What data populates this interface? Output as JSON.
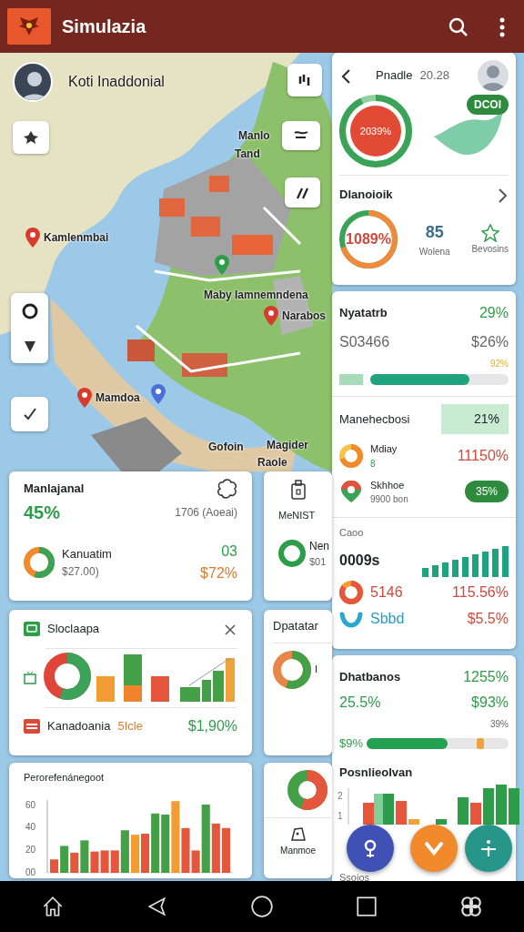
{
  "app_bar": {
    "title": "Simulazia"
  },
  "map": {
    "user_label": "Koti Inaddonial",
    "places": [
      {
        "label": "Kamlenmbai",
        "pin": true
      },
      {
        "label": "Manlo",
        "pin": false
      },
      {
        "label": "Tand",
        "pin": false
      },
      {
        "label": "Maby Iamnemndena",
        "pin": false
      },
      {
        "label": "Narabos",
        "pin": true
      },
      {
        "label": "Mamdoa",
        "pin": true
      },
      {
        "label": "Gofoin",
        "pin": false
      },
      {
        "label": "Magider",
        "pin": false
      },
      {
        "label": "Raole",
        "pin": false
      }
    ]
  },
  "profile_card": {
    "title": "Pnadle",
    "time": "20.28",
    "gauge": {
      "value": "2039%"
    },
    "badge": "DCOI",
    "section_title": "Dlanoioik",
    "stats": [
      {
        "kind": "gauge",
        "value": "1089%"
      },
      {
        "kind": "number",
        "value": "85",
        "label": "Wolena"
      },
      {
        "kind": "star",
        "label": "Bevosins"
      }
    ]
  },
  "stats_card": {
    "title": "Nyatatrb",
    "title_value": "29%",
    "subtitle": "S03466",
    "subtitle_value": "$26%",
    "progress": {
      "reading": "92%",
      "level": 0.72
    },
    "highlight": {
      "label": "Manehecbosi",
      "value": "21%"
    },
    "items": [
      {
        "kind": "ring",
        "title": "Mdiay",
        "subtitle": "8",
        "value": "11150%"
      },
      {
        "kind": "pin",
        "title": "Skhhoe",
        "subtitle": "9900 bon",
        "badge": "35%"
      }
    ],
    "trend": {
      "label": "Caoo",
      "value": "0009s"
    },
    "rows": [
      {
        "kind": "ring",
        "label": "5146",
        "value": "115.56%"
      },
      {
        "kind": "check",
        "label": "Sbbd",
        "value": "$5.5%"
      }
    ]
  },
  "finance_card": {
    "title": "Dhatbanos",
    "title_value": "1255%",
    "left_value": "25.5%",
    "right_value": "$93%",
    "progress": {
      "label": "$9%",
      "reading": "39%",
      "level": 0.57
    },
    "marker": {
      "level": 0.8
    },
    "chart_title": "Posnlieolvan",
    "chart_ticks": [
      "2",
      "1"
    ],
    "footer": "Ssoios"
  },
  "summary_card": {
    "title": "Manlajanal",
    "value": "45%",
    "note": "1706 (Aoeai)",
    "item": {
      "title": "Kanuatim",
      "subtitle": "$27.00)",
      "value": "03",
      "change": "$72%"
    }
  },
  "side_card_top": {
    "label": "MeNIST",
    "item_title": "Nen",
    "item_subtitle": "$01"
  },
  "chart_card": {
    "title": "Sloclaapa",
    "footer_label": "Kanadoania",
    "footer_tag": "5Icle",
    "footer_value": "$1,90%"
  },
  "side_card_middle": {
    "title": "Dpatatar",
    "note": "I"
  },
  "bar_chart_card": {
    "chart_data": {
      "type": "bar",
      "title": "Perorefenánegoot",
      "categories": [
        null,
        null,
        null,
        null,
        null,
        null,
        null,
        null,
        null,
        null,
        null,
        null,
        null,
        null,
        null,
        null,
        null,
        null
      ],
      "ylim": [
        0,
        65
      ],
      "yticks": [
        {
          "value": 0,
          "label": "00"
        },
        {
          "value": 20,
          "label": "20"
        },
        {
          "value": 40,
          "label": "40"
        },
        {
          "value": 60,
          "label": "60"
        }
      ],
      "series": [
        {
          "color": "#43a047",
          "values": [
            null,
            24,
            null,
            29,
            null,
            null,
            null,
            38,
            null,
            null,
            53,
            52,
            null,
            null,
            null,
            61,
            null,
            null
          ]
        },
        {
          "color": "#f39c34",
          "values": [
            null,
            null,
            null,
            null,
            null,
            null,
            null,
            null,
            34,
            null,
            null,
            null,
            64,
            null,
            null,
            null,
            null,
            null
          ]
        },
        {
          "color": "#e4573d",
          "values": [
            12,
            null,
            18,
            null,
            19,
            20,
            20,
            null,
            null,
            35,
            null,
            null,
            null,
            40,
            20,
            null,
            44,
            40
          ]
        }
      ]
    }
  },
  "side_card_bottom": {
    "label": "Manmoe"
  },
  "fabs": [
    {
      "kind": "person",
      "color": "#3f51b5"
    },
    {
      "kind": "heart",
      "color": "#f08a2c"
    },
    {
      "kind": "add",
      "color": "#26968a"
    }
  ]
}
